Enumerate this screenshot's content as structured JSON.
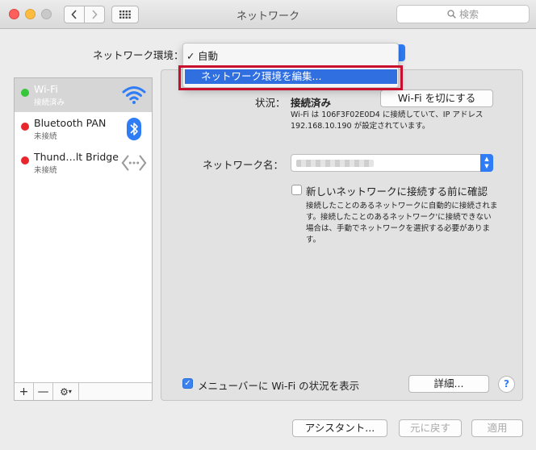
{
  "window": {
    "title": "ネットワーク"
  },
  "search": {
    "placeholder": "検索"
  },
  "location": {
    "label": "ネットワーク環境：",
    "menu": {
      "current": "自動",
      "edit_item": "ネットワーク環境を編集..."
    }
  },
  "sidebar": {
    "services": [
      {
        "name": "Wi-Fi",
        "status": "接続済み",
        "status_color": "#35c639",
        "icon": "wifi-icon"
      },
      {
        "name": "Bluetooth PAN",
        "status": "未接続",
        "status_color": "#e8262c",
        "icon": "bluetooth-icon"
      },
      {
        "name": "Thund…lt Bridge",
        "status": "未接続",
        "status_color": "#e8262c",
        "icon": "thunderbolt-bridge-icon"
      }
    ],
    "footer": {
      "add": "+",
      "remove": "—"
    }
  },
  "detail": {
    "status_label": "状況：",
    "status_value": "接続済み",
    "wifi_off_button": "Wi-Fi を切にする",
    "status_description": "Wi-Fi は 106F3F02E0D4 に接続していて、IP アドレス 192.168.10.190 が設定されています。",
    "network_name_label": "ネットワーク名：",
    "ask_to_join_label": "新しいネットワークに接続する前に確認",
    "ask_to_join_description": "接続したことのあるネットワークに自動的に接続されます。接続したことのあるネットワーク'に接続できない場合は、手動でネットワークを選択する必要があります。",
    "menubar_label": "メニューバーに Wi-Fi の状況を表示",
    "advanced_button": "詳細...",
    "help_button": "?"
  },
  "bottom": {
    "assist_button": "アシスタント...",
    "revert_button": "元に戻す",
    "apply_button": "適用"
  },
  "colors": {
    "accent": "#2f7df6",
    "highlight": "#c8102e"
  }
}
